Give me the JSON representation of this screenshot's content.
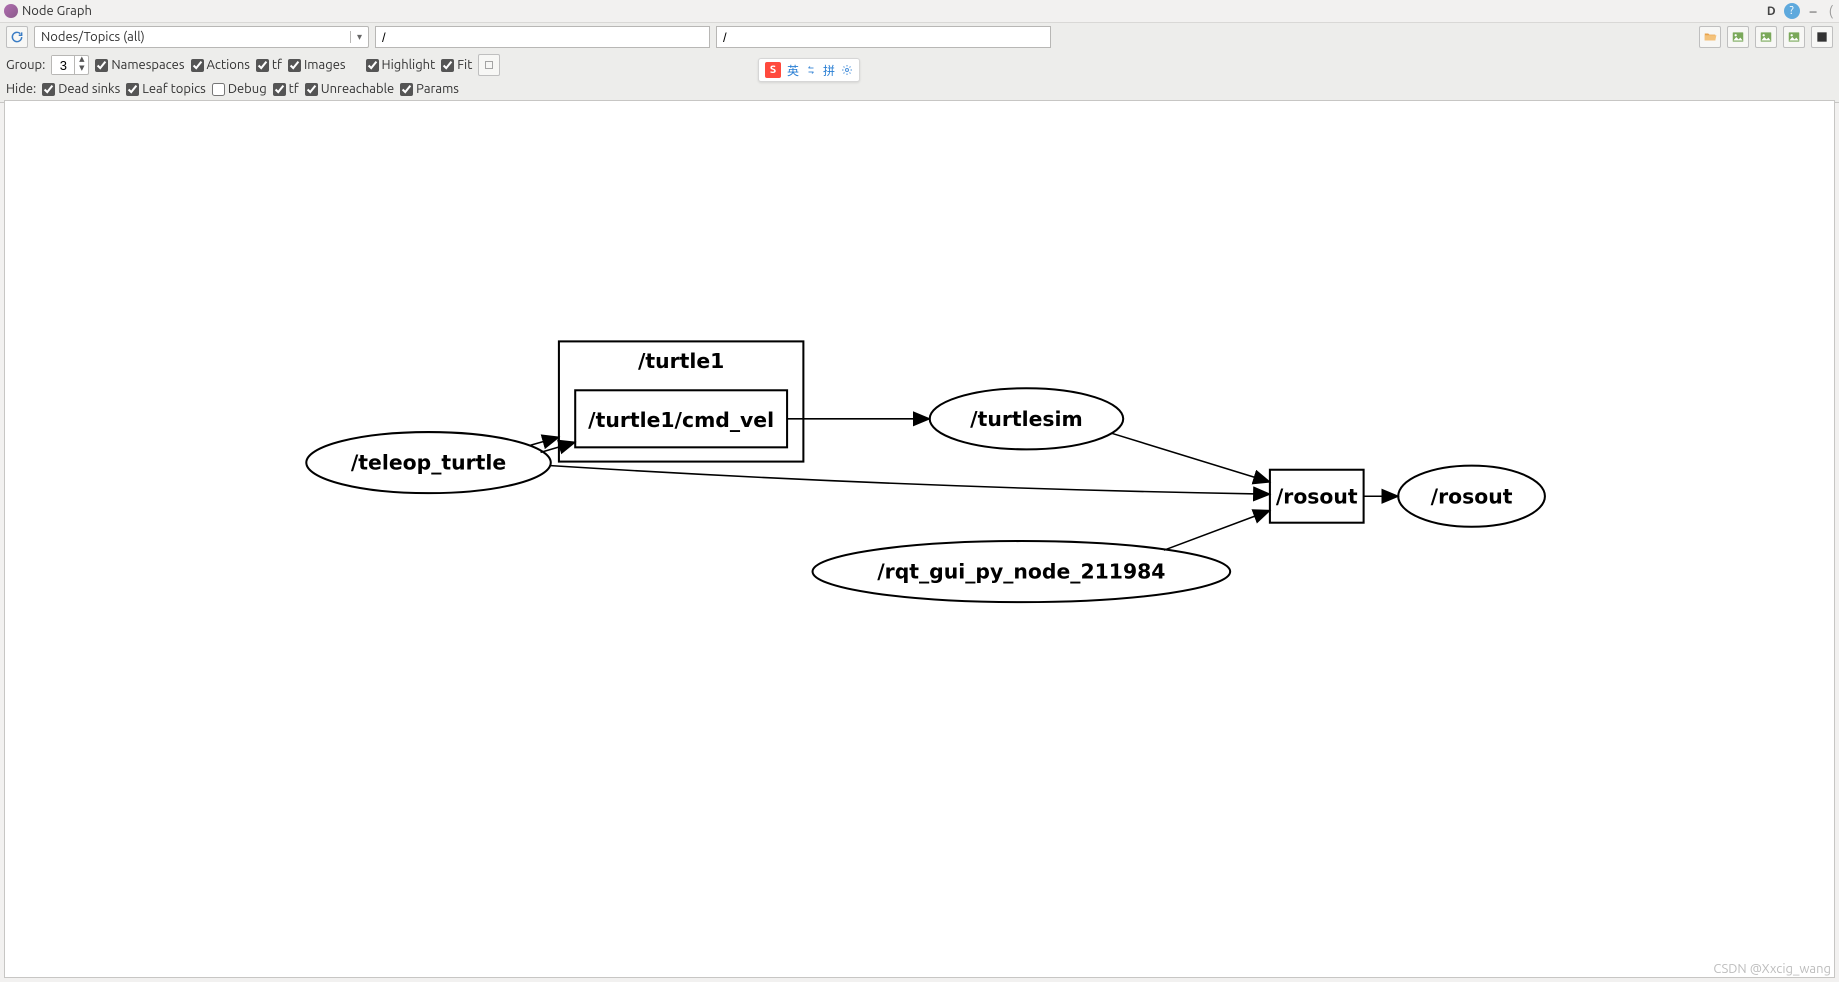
{
  "window": {
    "title": "Node Graph",
    "d_button": "D"
  },
  "toolbar": {
    "combo_value": "Nodes/Topics (all)",
    "filter1_value": "/",
    "filter2_value": "/"
  },
  "row2": {
    "group_label": "Group:",
    "group_value": "3",
    "namespaces_label": "Namespaces",
    "actions_label": "Actions",
    "tf_label": "tf",
    "images_label": "Images",
    "highlight_label": "Highlight",
    "fit_label": "Fit"
  },
  "row3": {
    "hide_label": "Hide:",
    "dead_sinks_label": "Dead sinks",
    "leaf_topics_label": "Leaf topics",
    "debug_label": "Debug",
    "tf_label": "tf",
    "unreachable_label": "Unreachable",
    "params_label": "Params"
  },
  "ime": {
    "lang": "英",
    "mode": "拼"
  },
  "graph": {
    "namespace_box": "/turtle1",
    "topic_cmdvel": "/turtle1/cmd_vel",
    "node_teleop": "/teleop_turtle",
    "node_turtlesim": "/turtlesim",
    "node_rqt": "/rqt_gui_py_node_211984",
    "topic_rosout": "/rosout",
    "node_rosout": "/rosout"
  },
  "watermark": "CSDN @Xxcig_wang"
}
